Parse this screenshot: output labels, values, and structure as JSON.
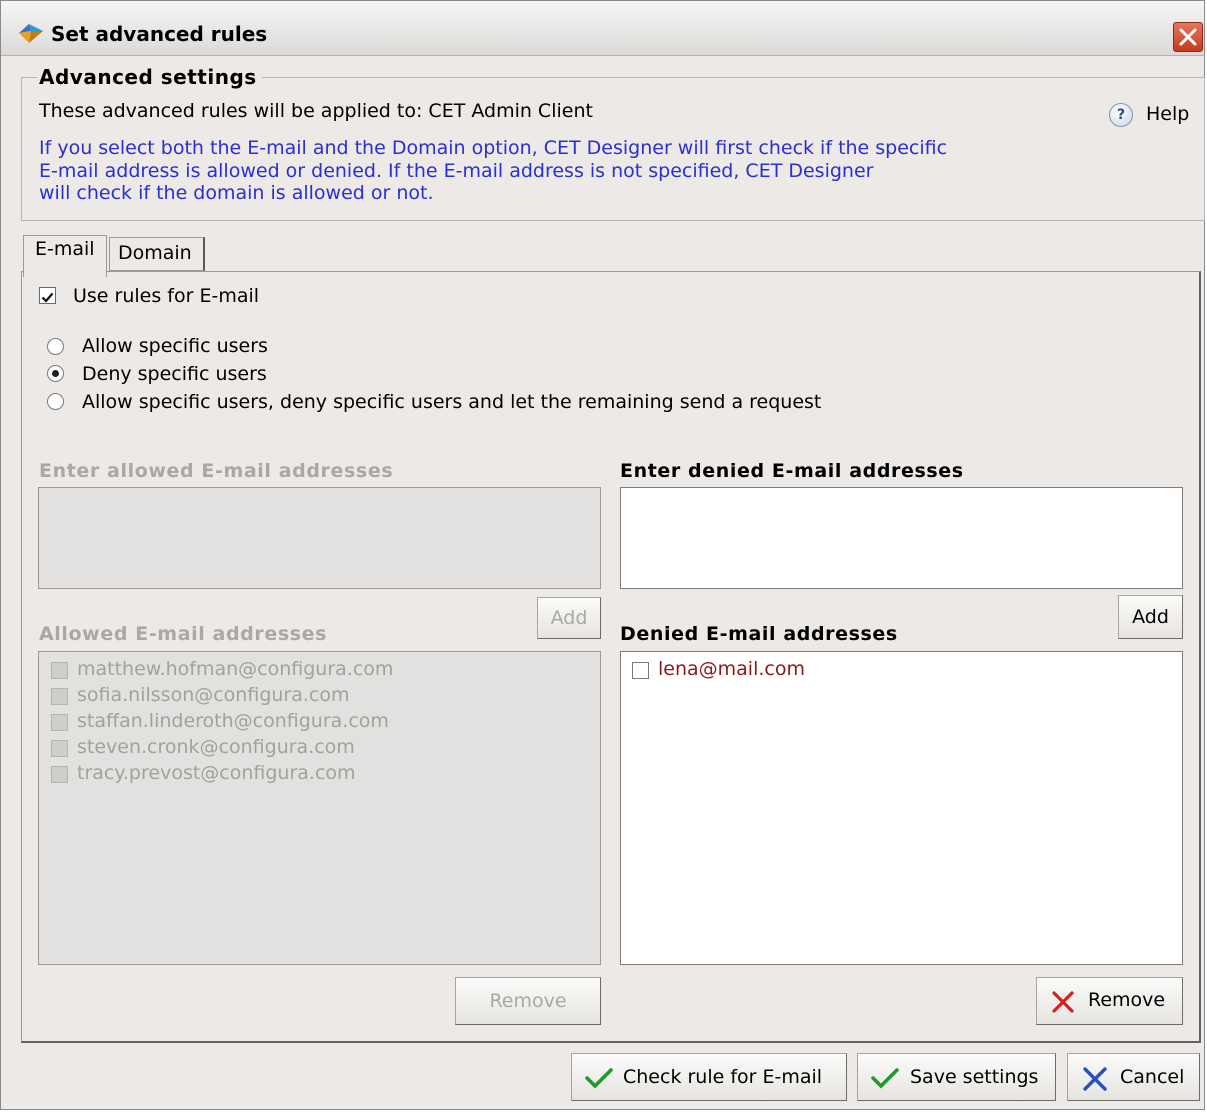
{
  "window": {
    "title": "Set advanced rules"
  },
  "advanced": {
    "legend": "Advanced settings",
    "applied_text": "These advanced rules will be applied to: CET Admin Client",
    "help_label": "Help",
    "info_lines": [
      "If you select both the E-mail and the Domain option, CET Designer will first check if the specific",
      "E-mail address is allowed or denied. If the E-mail address is not specified, CET Designer",
      "will check if the domain is allowed or not."
    ]
  },
  "tabs": [
    {
      "label": "E-mail",
      "selected": true
    },
    {
      "label": "Domain",
      "selected": false
    }
  ],
  "email_tab": {
    "use_rules_label": "Use rules for E-mail",
    "use_rules_checked": true,
    "options": [
      {
        "label": "Allow specific users",
        "selected": false
      },
      {
        "label": "Deny specific users",
        "selected": true
      },
      {
        "label": "Allow specific users, deny specific users and let the remaining send a request",
        "selected": false
      }
    ],
    "allowed": {
      "enter_header": "Enter allowed E-mail addresses",
      "list_header": "Allowed E-mail addresses",
      "add_label": "Add",
      "remove_label": "Remove",
      "enabled": false,
      "items": [
        "matthew.hofman@configura.com",
        "sofia.nilsson@configura.com",
        "staffan.linderoth@configura.com",
        "steven.cronk@configura.com",
        "tracy.prevost@configura.com"
      ]
    },
    "denied": {
      "enter_header": "Enter denied E-mail addresses",
      "list_header": "Denied E-mail addresses",
      "add_label": "Add",
      "remove_label": "Remove",
      "enabled": true,
      "items": [
        "lena@mail.com"
      ]
    }
  },
  "footer": {
    "check_label": "Check rule for E-mail",
    "save_label": "Save settings",
    "cancel_label": "Cancel"
  },
  "colors": {
    "info_text": "#2a30cf",
    "denied_item": "#8c1a1a",
    "check_green": "#1e9a2a",
    "remove_red": "#d42020",
    "cancel_blue": "#2a50c0"
  }
}
